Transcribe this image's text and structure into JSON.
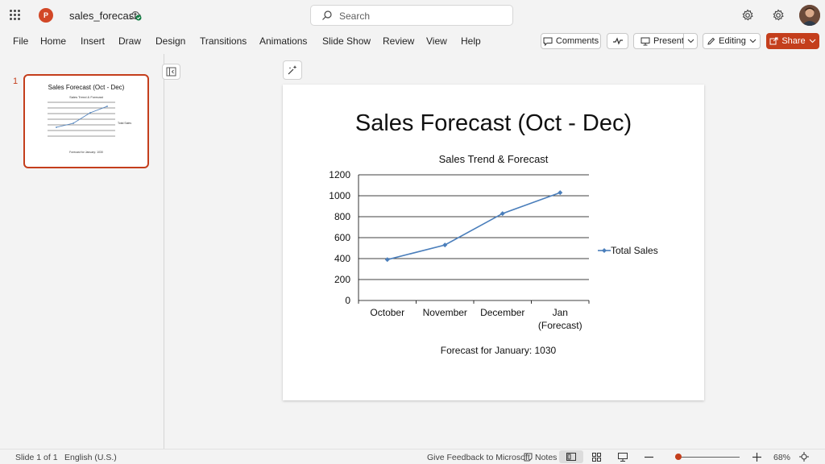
{
  "app": {
    "filename": "sales_forecast",
    "search_placeholder": "Search"
  },
  "menu": [
    "File",
    "Home",
    "Insert",
    "Draw",
    "Design",
    "Transitions",
    "Animations",
    "Slide Show",
    "Review",
    "View",
    "Help"
  ],
  "toolbar": {
    "comments": "Comments",
    "present": "Present",
    "editing": "Editing",
    "share": "Share"
  },
  "thumbnails": [
    {
      "number": "1",
      "title": "Sales Forecast (Oct - Dec)",
      "chart_title": "Sales Trend & Forecast",
      "legend": "Total Sales",
      "note": "Forecast for January: 1030"
    }
  ],
  "slide": {
    "title": "Sales Forecast (Oct - Dec)",
    "note": "Forecast for January: 1030"
  },
  "chart_data": {
    "type": "line",
    "title": "Sales Trend & Forecast",
    "categories": [
      "October",
      "November",
      "December",
      "Jan (Forecast)"
    ],
    "series": [
      {
        "name": "Total Sales",
        "values": [
          390,
          530,
          830,
          1030
        ]
      }
    ],
    "ylim": [
      0,
      1200
    ],
    "yticks": [
      0,
      200,
      400,
      600,
      800,
      1000,
      1200
    ],
    "grid": true,
    "legend": "right",
    "color": "#4a7ebb"
  },
  "status": {
    "slide": "Slide 1 of 1",
    "language": "English (U.S.)",
    "feedback": "Give Feedback to Microsoft",
    "notes": "Notes",
    "zoom": "68%"
  },
  "colors": {
    "accent": "#c43e1c"
  }
}
